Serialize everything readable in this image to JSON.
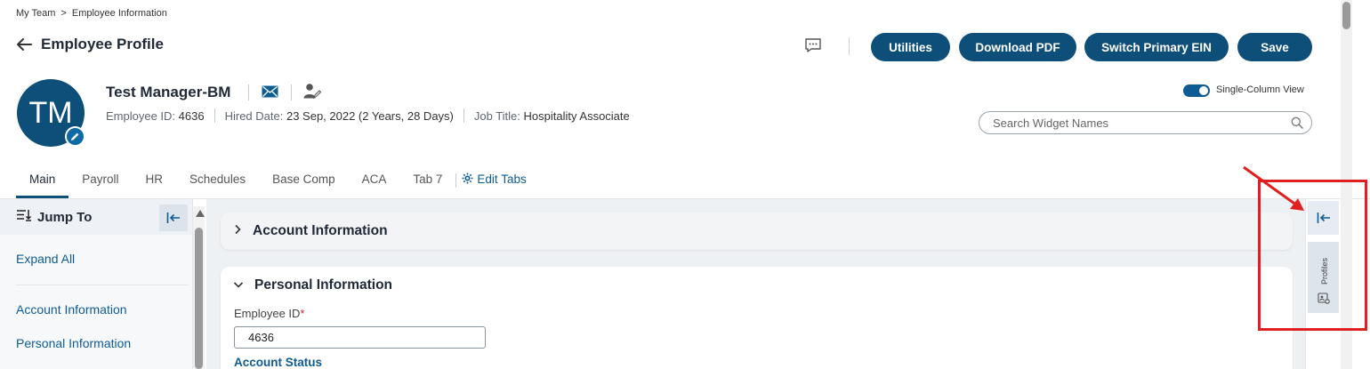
{
  "breadcrumb": {
    "root": "My Team",
    "separator": ">",
    "current": "Employee Information"
  },
  "page": {
    "title": "Employee Profile"
  },
  "actions": {
    "utilities": "Utilities",
    "download_pdf": "Download PDF",
    "switch_ein": "Switch Primary EIN",
    "save": "Save"
  },
  "employee": {
    "initials": "TM",
    "name": "Test Manager-BM",
    "id_label": "Employee ID:",
    "id_value": "4636",
    "hired_label": "Hired Date:",
    "hired_value": "23 Sep, 2022 (2 Years, 28 Days)",
    "job_label": "Job Title:",
    "job_value": "Hospitality Associate"
  },
  "view": {
    "single_column_label": "Single-Column View",
    "single_column_on": true
  },
  "search": {
    "placeholder": "Search Widget Names"
  },
  "tabs": [
    {
      "label": "Main",
      "active": true
    },
    {
      "label": "Payroll"
    },
    {
      "label": "HR"
    },
    {
      "label": "Schedules"
    },
    {
      "label": "Base Comp"
    },
    {
      "label": "ACA"
    },
    {
      "label": "Tab 7"
    }
  ],
  "edit_tabs": "Edit Tabs",
  "jump": {
    "title": "Jump To",
    "expand_all": "Expand All",
    "links": [
      "Account Information",
      "Personal Information"
    ]
  },
  "sections": {
    "account": "Account Information",
    "personal": "Personal Information",
    "employee_id_label": "Employee ID",
    "required_mark": "*",
    "employee_id_value": "4636",
    "account_status_label": "Account Status"
  },
  "rail": {
    "profiles": "Profiles"
  },
  "colors": {
    "primary": "#0e4f7a",
    "link": "#0e5c94",
    "annotation": "#e02020"
  }
}
